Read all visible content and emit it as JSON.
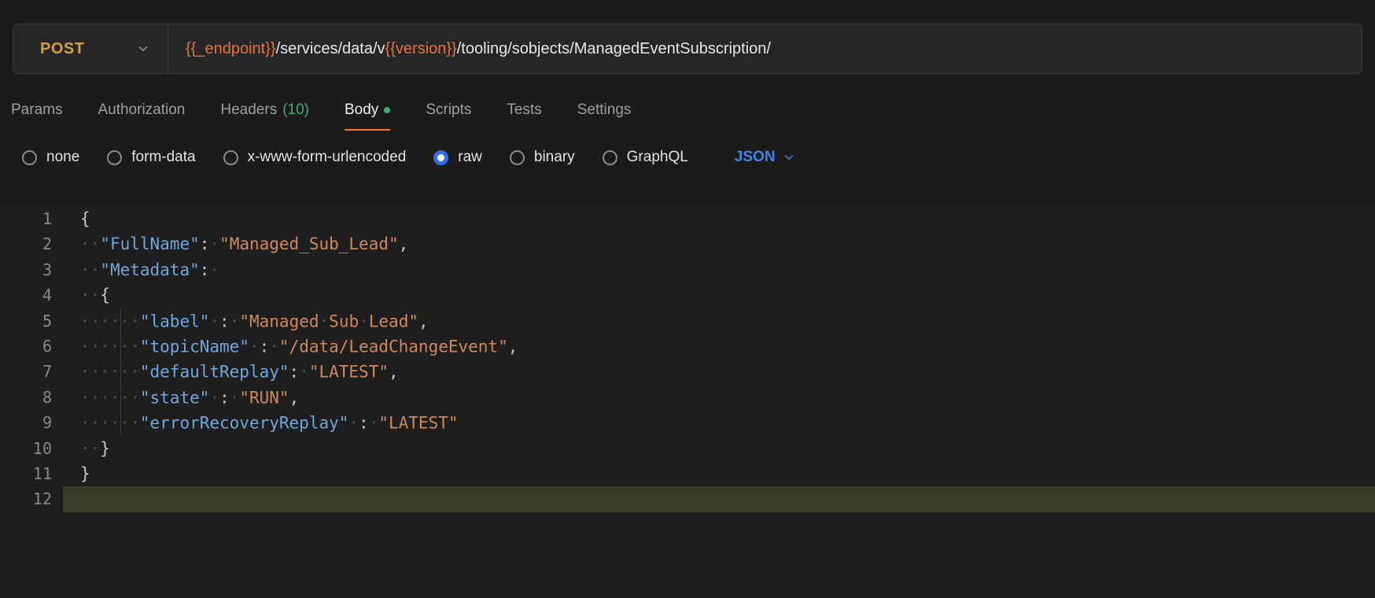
{
  "request": {
    "method": "POST",
    "url_segments": [
      {
        "text": "{{_endpoint}}",
        "type": "variable"
      },
      {
        "text": "/services/data/v",
        "type": "plain"
      },
      {
        "text": "{{version}}",
        "type": "variable"
      },
      {
        "text": "/tooling/sobjects/ManagedEventSubscription/",
        "type": "plain"
      }
    ]
  },
  "tabs": [
    {
      "label": "Params"
    },
    {
      "label": "Authorization"
    },
    {
      "label": "Headers",
      "count": "(10)"
    },
    {
      "label": "Body",
      "active": true,
      "dot": true
    },
    {
      "label": "Scripts"
    },
    {
      "label": "Tests"
    },
    {
      "label": "Settings"
    }
  ],
  "body_types": [
    {
      "label": "none"
    },
    {
      "label": "form-data"
    },
    {
      "label": "x-www-form-urlencoded"
    },
    {
      "label": "raw",
      "selected": true
    },
    {
      "label": "binary"
    },
    {
      "label": "GraphQL"
    }
  ],
  "language_selector": {
    "label": "JSON"
  },
  "editor": {
    "lines": [
      {
        "num": "1",
        "tokens": [
          [
            "p",
            "{"
          ]
        ]
      },
      {
        "num": "2",
        "tokens": [
          [
            "w",
            "··"
          ],
          [
            "k",
            "\"FullName\""
          ],
          [
            "p",
            ":"
          ],
          [
            "w",
            "·"
          ],
          [
            "v",
            "\"Managed_Sub_Lead\""
          ],
          [
            "p",
            ","
          ]
        ]
      },
      {
        "num": "3",
        "tokens": [
          [
            "w",
            "··"
          ],
          [
            "k",
            "\"Metadata\""
          ],
          [
            "p",
            ":"
          ],
          [
            "w",
            "·"
          ]
        ]
      },
      {
        "num": "4",
        "tokens": [
          [
            "w",
            "··"
          ],
          [
            "p",
            "{"
          ]
        ]
      },
      {
        "num": "5",
        "tokens": [
          [
            "w",
            "····"
          ],
          [
            "g",
            ""
          ],
          [
            "w",
            "··"
          ],
          [
            "k",
            "\"label\""
          ],
          [
            "w",
            "·"
          ],
          [
            "p",
            ":"
          ],
          [
            "w",
            "·"
          ],
          [
            "v",
            "\"Managed"
          ],
          [
            "w",
            "·"
          ],
          [
            "v",
            "Sub"
          ],
          [
            "w",
            "·"
          ],
          [
            "v",
            "Lead\""
          ],
          [
            "p",
            ","
          ]
        ]
      },
      {
        "num": "6",
        "tokens": [
          [
            "w",
            "····"
          ],
          [
            "g",
            ""
          ],
          [
            "w",
            "··"
          ],
          [
            "k",
            "\"topicName\""
          ],
          [
            "w",
            "·"
          ],
          [
            "p",
            ":"
          ],
          [
            "w",
            "·"
          ],
          [
            "v",
            "\"/data/LeadChangeEvent\""
          ],
          [
            "p",
            ","
          ]
        ]
      },
      {
        "num": "7",
        "tokens": [
          [
            "w",
            "····"
          ],
          [
            "g",
            ""
          ],
          [
            "w",
            "··"
          ],
          [
            "k",
            "\"defaultReplay\""
          ],
          [
            "p",
            ":"
          ],
          [
            "w",
            "·"
          ],
          [
            "v",
            "\"LATEST\""
          ],
          [
            "p",
            ","
          ]
        ]
      },
      {
        "num": "8",
        "tokens": [
          [
            "w",
            "····"
          ],
          [
            "g",
            ""
          ],
          [
            "w",
            "··"
          ],
          [
            "k",
            "\"state\""
          ],
          [
            "w",
            "·"
          ],
          [
            "p",
            ":"
          ],
          [
            "w",
            "·"
          ],
          [
            "v",
            "\"RUN\""
          ],
          [
            "p",
            ","
          ]
        ]
      },
      {
        "num": "9",
        "tokens": [
          [
            "w",
            "····"
          ],
          [
            "g",
            ""
          ],
          [
            "w",
            "··"
          ],
          [
            "k",
            "\"errorRecoveryReplay\""
          ],
          [
            "w",
            "·"
          ],
          [
            "p",
            ":"
          ],
          [
            "w",
            "·"
          ],
          [
            "v",
            "\"LATEST\""
          ]
        ]
      },
      {
        "num": "10",
        "tokens": [
          [
            "w",
            "··"
          ],
          [
            "p",
            "}"
          ]
        ]
      },
      {
        "num": "11",
        "tokens": [
          [
            "p",
            "}"
          ]
        ]
      },
      {
        "num": "12",
        "tokens": [],
        "current": true
      }
    ]
  },
  "colors": {
    "method_post": "#d0a147",
    "url_variable": "#e8743f",
    "tab_active_underline": "#ff6c37",
    "success_green": "#3fae75",
    "radio_selected_blue": "#2e6ff2",
    "language_blue": "#4285e8",
    "json_key": "#6fa8dc",
    "json_value": "#ce8a5c",
    "current_line_highlight": "#3a3c28"
  }
}
